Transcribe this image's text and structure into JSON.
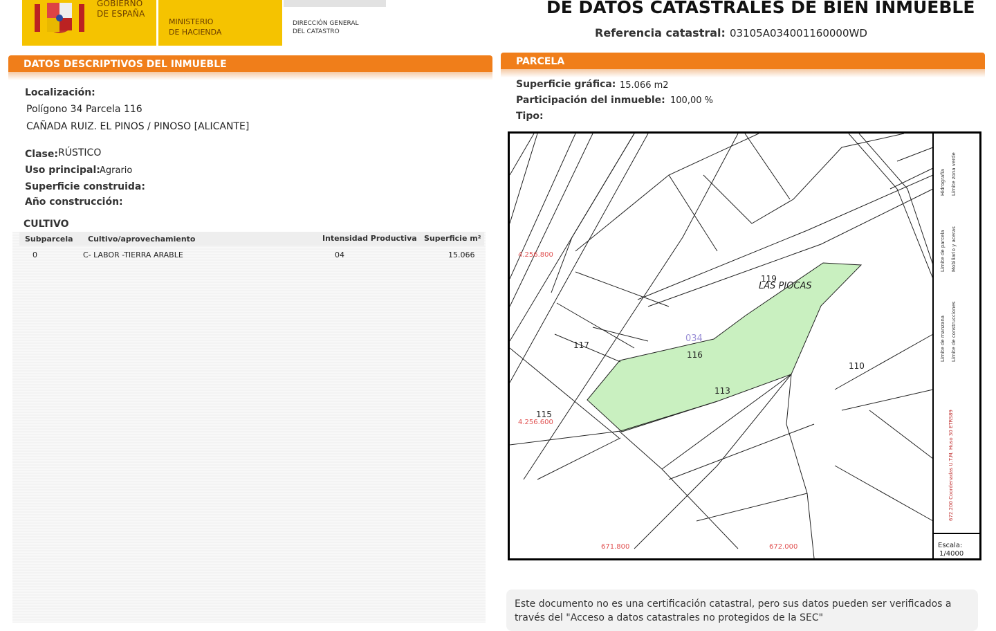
{
  "header": {
    "gov_line1": "GOBIERNO",
    "gov_line2": "DE ESPAÑA",
    "ministry_line1": "MINISTERIO",
    "ministry_line2": "DE HACIENDA",
    "dg_line1": "DIRECCIÓN GENERAL",
    "dg_line2": "DEL CATASTRO",
    "title": "DE DATOS CATASTRALES DE BIEN INMUEBLE",
    "ref_label": "Referencia catastral:",
    "ref_value": "03105A034001160000WD"
  },
  "left": {
    "section_title": "DATOS DESCRIPTIVOS DEL INMUEBLE",
    "localizacion_label": "Localización:",
    "localizacion_line1": "Polígono 34 Parcela 116",
    "localizacion_line2": "CAÑADA RUIZ. EL PINOS / PINOSO [ALICANTE]",
    "clase_label": "Clase:",
    "clase_value": "RÚSTICO",
    "uso_label": "Uso principal:",
    "uso_value": "Agrario",
    "superficie_label": "Superficie construida:",
    "anio_label": "Año construcción:",
    "cultivo_title": "CULTIVO",
    "table_headers": [
      "Subparcela",
      "Cultivo/aprovechamiento",
      "Intensidad Productiva",
      "Superficie m²"
    ],
    "table_row": [
      "0",
      "C- LABOR -TIERRA ARABLE",
      "04",
      "15.066"
    ]
  },
  "right": {
    "section_title": "PARCELA",
    "sup_grafica_label": "Superficie gráfica:",
    "sup_grafica_value": "15.066 m2",
    "participacion_label": "Participación del inmueble:",
    "participacion_value": "100,00 %",
    "tipo_label": "Tipo:",
    "map": {
      "parcel_labels": [
        "117",
        "116",
        "113",
        "115",
        "110",
        "119",
        "034"
      ],
      "place_name": "LAS PIOCAS",
      "coord_labels": [
        "4.256.800",
        "4.256.600",
        "671.800",
        "672.000"
      ],
      "legend_items": [
        "Límite de manzana",
        "Límite de parcela",
        "Hidrografía",
        "Límite de construcciones",
        "Mobiliario y aceras",
        "Límite zona verde"
      ],
      "projection_text": "672.200 Coordenadas U.T.M. Huso 30 ETRS89",
      "scale_label": "Escala:",
      "scale_value": "1/4000",
      "highlight_color": "#c9f0c0"
    },
    "note_line1": "Este documento no es una certificación catastral, pero sus datos pueden ser verificados a",
    "note_line2": "través del \"Acceso a datos catastrales no protegidos de la SEC\""
  }
}
